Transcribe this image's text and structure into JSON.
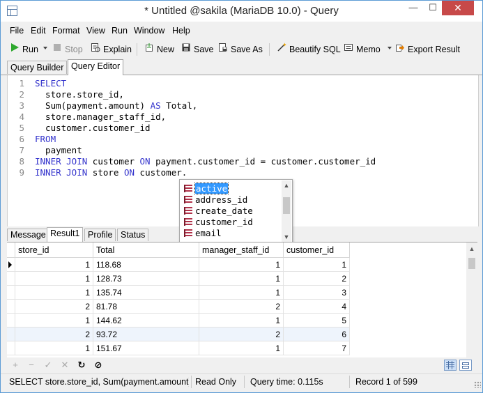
{
  "window": {
    "title": "* Untitled @sakila (MariaDB 10.0) - Query"
  },
  "menu": [
    "File",
    "Edit",
    "Format",
    "View",
    "Run",
    "Window",
    "Help"
  ],
  "toolbar": {
    "run": "Run",
    "stop": "Stop",
    "explain": "Explain",
    "new": "New",
    "save": "Save",
    "save_as": "Save As",
    "beautify": "Beautify SQL",
    "memo": "Memo",
    "export": "Export Result"
  },
  "tabs": [
    "Query Builder",
    "Query Editor"
  ],
  "editor": {
    "lines": [
      {
        "n": "1",
        "segs": [
          {
            "t": "SELECT",
            "k": 1
          }
        ]
      },
      {
        "n": "2",
        "segs": [
          {
            "t": "  store.store_id,",
            "k": 0
          }
        ]
      },
      {
        "n": "3",
        "segs": [
          {
            "t": "  Sum(payment.amount) ",
            "k": 0
          },
          {
            "t": "AS",
            "k": 1
          },
          {
            "t": " Total,",
            "k": 0
          }
        ]
      },
      {
        "n": "4",
        "segs": [
          {
            "t": "  store.manager_staff_id,",
            "k": 0
          }
        ]
      },
      {
        "n": "5",
        "segs": [
          {
            "t": "  customer.customer_id",
            "k": 0
          }
        ]
      },
      {
        "n": "6",
        "segs": [
          {
            "t": "FROM",
            "k": 1
          }
        ]
      },
      {
        "n": "7",
        "segs": [
          {
            "t": "  payment",
            "k": 0
          }
        ]
      },
      {
        "n": "8",
        "segs": [
          {
            "t": "INNER JOIN",
            "k": 1
          },
          {
            "t": " customer ",
            "k": 0
          },
          {
            "t": "ON",
            "k": 1
          },
          {
            "t": " payment.customer_id = customer.customer_id",
            "k": 0
          }
        ]
      },
      {
        "n": "9",
        "segs": [
          {
            "t": "INNER JOIN",
            "k": 1
          },
          {
            "t": " store ",
            "k": 0
          },
          {
            "t": "ON",
            "k": 1
          },
          {
            "t": " customer.",
            "k": 0
          }
        ]
      }
    ]
  },
  "autocomplete": {
    "items": [
      "active",
      "address_id",
      "create_date",
      "customer_id",
      "email"
    ],
    "selected": 0
  },
  "result_tabs": [
    "Message",
    "Result1",
    "Profile",
    "Status"
  ],
  "grid": {
    "columns": [
      "store_id",
      "Total",
      "manager_staff_id",
      "customer_id"
    ],
    "rows": [
      [
        "1",
        "118.68",
        "1",
        "1"
      ],
      [
        "1",
        "128.73",
        "1",
        "2"
      ],
      [
        "1",
        "135.74",
        "1",
        "3"
      ],
      [
        "2",
        "81.78",
        "2",
        "4"
      ],
      [
        "1",
        "144.62",
        "1",
        "5"
      ],
      [
        "2",
        "93.72",
        "2",
        "6"
      ],
      [
        "1",
        "151.67",
        "1",
        "7"
      ]
    ]
  },
  "navbar": {
    "add": "+",
    "delete": "−",
    "apply": "✓",
    "cancel": "✕",
    "refresh": "↻",
    "stop": "⊘"
  },
  "status": {
    "sql": "SELECT store.store_id, Sum(payment.amount) AS",
    "mode": "Read Only",
    "query_time": "Query time: 0.115s",
    "record": "Record 1 of 599"
  },
  "colors": {
    "keyword": "#3333cc",
    "selection": "#3399ff",
    "close": "#c74949"
  }
}
